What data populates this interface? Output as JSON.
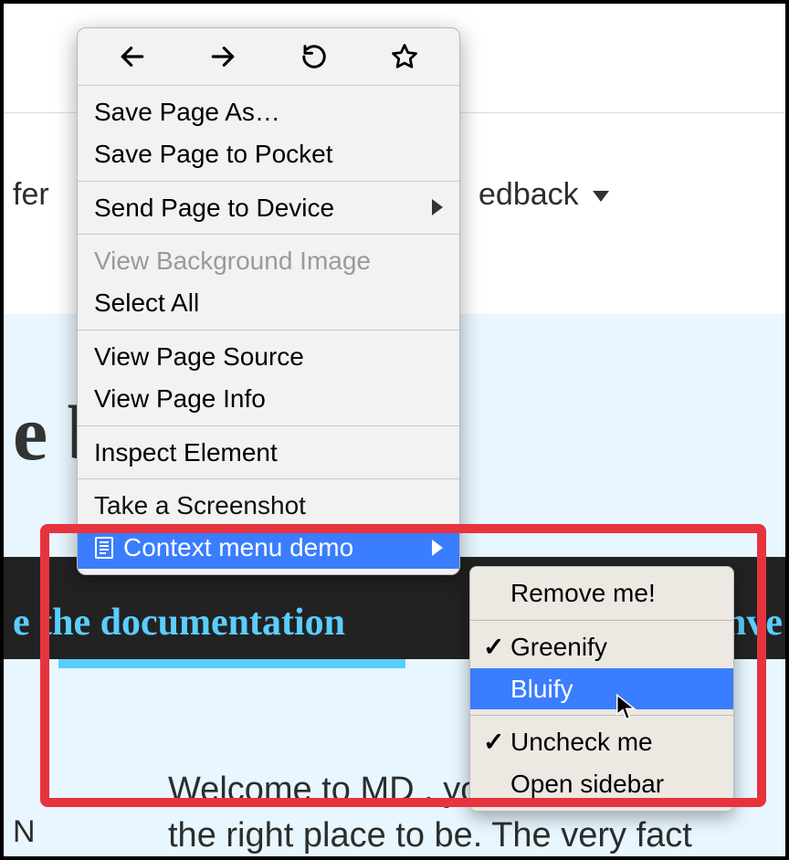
{
  "background": {
    "nav_left_fragment": "fer",
    "nav_right_fragment": "edback",
    "hero_fragment": "e                      bout M",
    "doc_link_fragment": "e the documentation",
    "doc_link_right_fragment": "nve",
    "body_line1_fragment": "Welcome to MD         .    you   u.e sug",
    "body_line2_fragment": "the right place to be. The very fact",
    "on_fragment": "N",
    "screenshot_fragment": "Take a Screenshot"
  },
  "context_menu": {
    "groups": [
      {
        "items": [
          {
            "label": "Save Page As…"
          },
          {
            "label": "Save Page to Pocket"
          }
        ]
      },
      {
        "items": [
          {
            "label": "Send Page to Device",
            "has_submenu": true
          }
        ]
      },
      {
        "items": [
          {
            "label": "View Background Image",
            "disabled": true
          },
          {
            "label": "Select All"
          }
        ]
      },
      {
        "items": [
          {
            "label": "View Page Source"
          },
          {
            "label": "View Page Info"
          }
        ]
      },
      {
        "items": [
          {
            "label": "Inspect Element"
          }
        ]
      }
    ],
    "context_demo_label": "Context menu demo"
  },
  "submenu": {
    "groups": [
      {
        "items": [
          {
            "label": "Remove me!"
          }
        ]
      },
      {
        "items": [
          {
            "label": "Greenify",
            "checked": true
          },
          {
            "label": "Bluify",
            "selected": true
          }
        ]
      },
      {
        "items": [
          {
            "label": "Uncheck me",
            "checked": true
          },
          {
            "label": "Open sidebar"
          }
        ]
      }
    ]
  }
}
